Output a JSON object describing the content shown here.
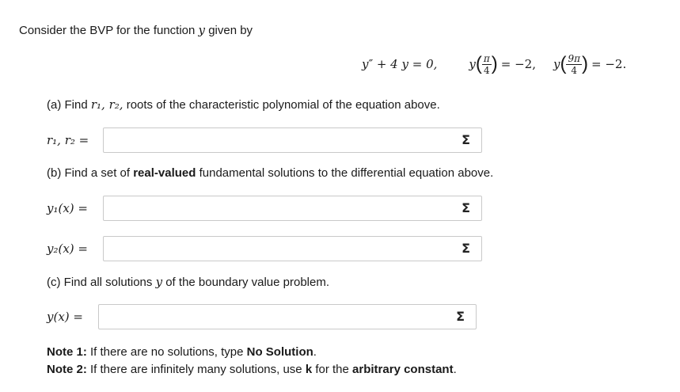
{
  "intro": {
    "text_before": "Consider the BVP for the function",
    "var": "y",
    "text_after": "given by"
  },
  "bvp": {
    "ode_lhs": "y″ + 4 y = 0,",
    "bc1_fn": "y",
    "bc1_num": "π",
    "bc1_den": "4",
    "bc1_rhs": "= −2,",
    "bc2_fn": "y",
    "bc2_num": "9π",
    "bc2_den": "4",
    "bc2_rhs": "= −2."
  },
  "part_a": {
    "prompt_before": "(a) Find",
    "prompt_vars": "r₁, r₂,",
    "prompt_after": "roots of the characteristic polynomial of the equation above.",
    "label": "r₁, r₂ =",
    "value": ""
  },
  "part_b": {
    "prompt_before": "(b) Find a set of",
    "prompt_bold": "real-valued",
    "prompt_after": "fundamental solutions to the differential equation above.",
    "label_y1": "y₁(x) =",
    "value_y1": "",
    "label_y2": "y₂(x) =",
    "value_y2": ""
  },
  "part_c": {
    "prompt_before": "(c) Find all solutions",
    "prompt_var": "y",
    "prompt_after": "of the boundary value problem.",
    "label": "y(x) =",
    "value": ""
  },
  "notes": {
    "note1_label": "Note 1:",
    "note1_before": "If there are no solutions, type",
    "note1_bold": "No Solution",
    "note1_after": ".",
    "note2_label": "Note 2:",
    "note2_before": "If there are infinitely many solutions, use",
    "note2_k": "k",
    "note2_middle": "for the",
    "note2_bold": "arbitrary constant",
    "note2_after": "."
  },
  "icons": {
    "sigma": "Σ",
    "sigma_icon_name": "sigma-equation-editor-icon"
  }
}
